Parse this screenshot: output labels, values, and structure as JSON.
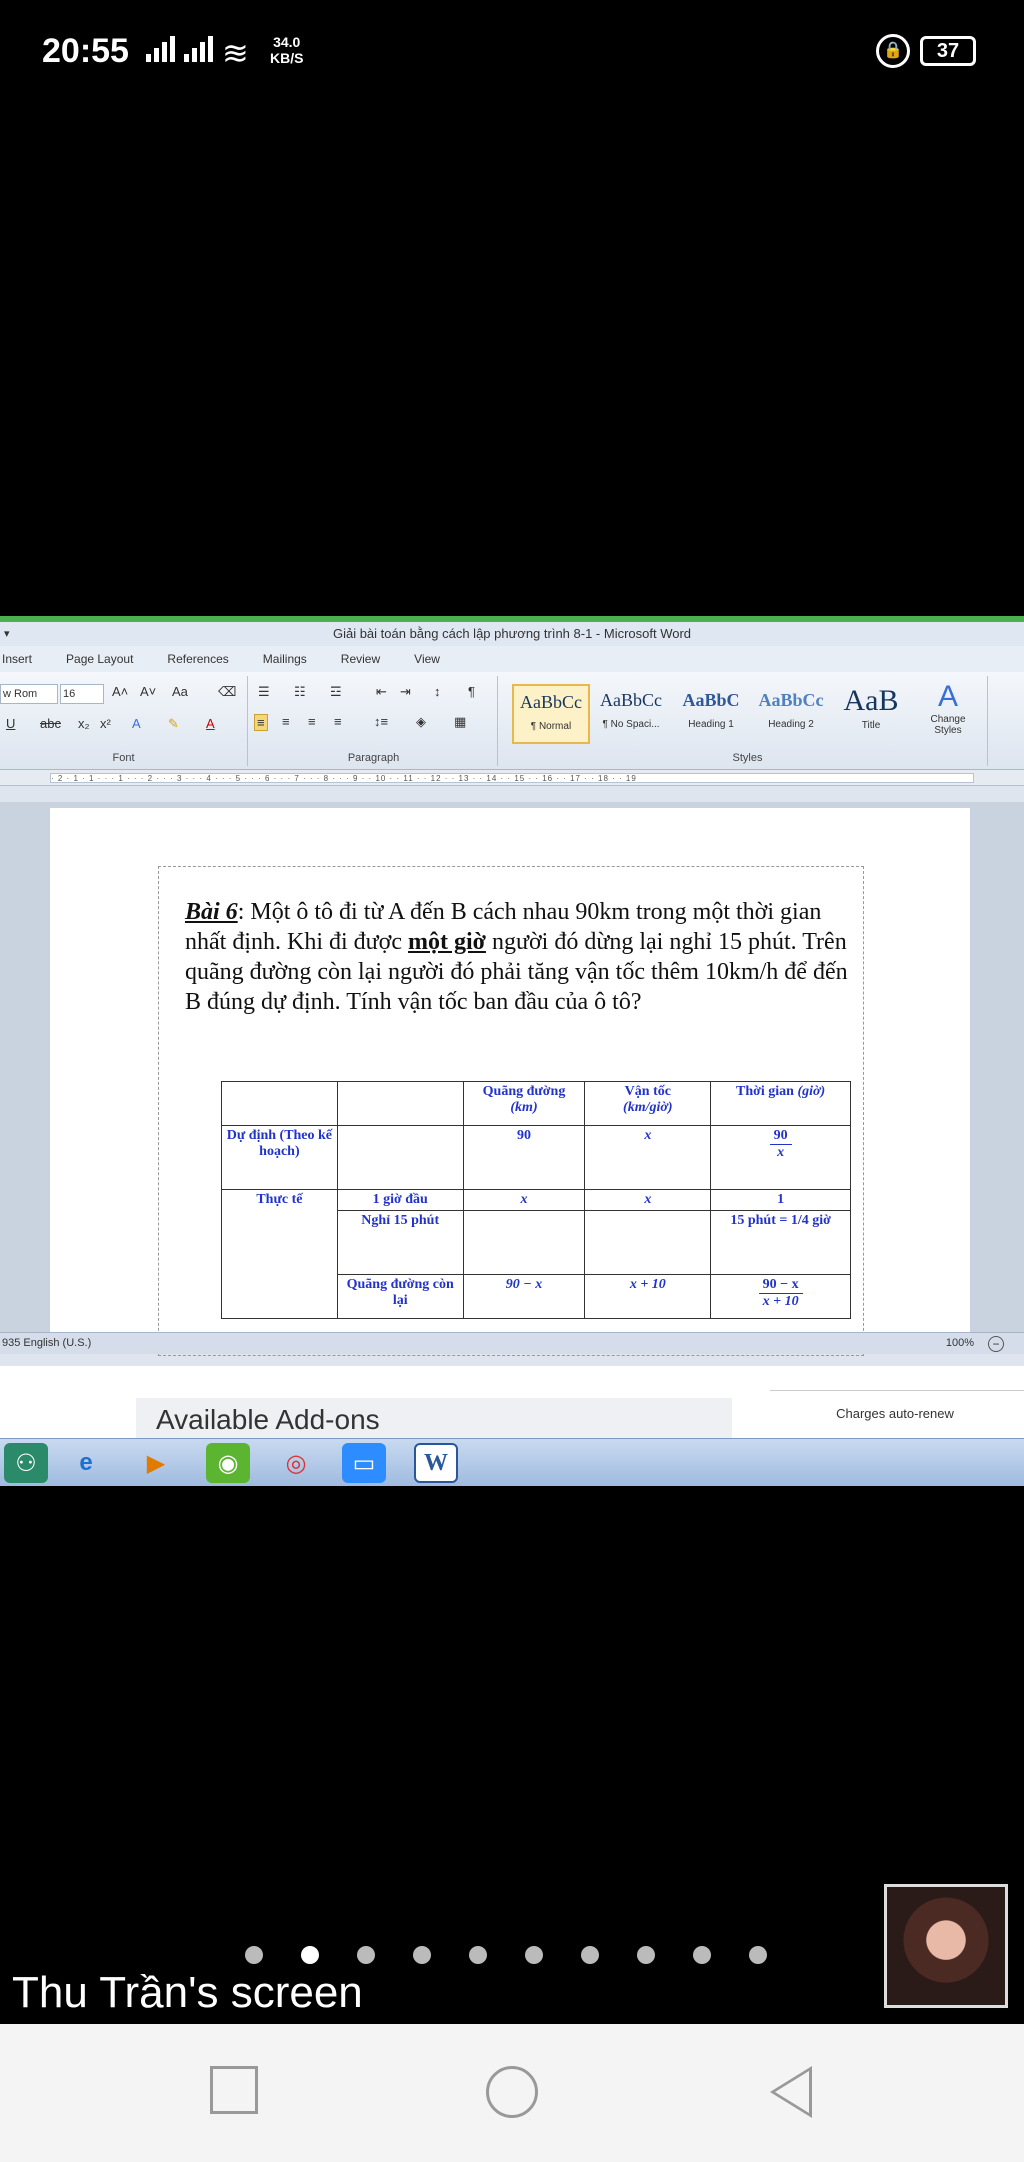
{
  "status": {
    "time": "20:55",
    "speed_value": "34.0",
    "speed_unit": "KB/S",
    "battery": "37"
  },
  "word": {
    "title": "Giải bài toán bằng cách lập phương trình 8-1  -  Microsoft Word",
    "tabs": [
      "Insert",
      "Page Layout",
      "References",
      "Mailings",
      "Review",
      "View"
    ],
    "font_name": "w Rom",
    "font_size": "16",
    "groups": {
      "font": "Font",
      "paragraph": "Paragraph",
      "styles": "Styles"
    },
    "styles": [
      {
        "sample": "AaBbCc",
        "name": "¶ Normal"
      },
      {
        "sample": "AaBbCc",
        "name": "¶ No Spaci..."
      },
      {
        "sample": "AaBbC",
        "name": "Heading 1"
      },
      {
        "sample": "AaBbCc",
        "name": "Heading 2"
      },
      {
        "sample": "AaB",
        "name": "Title"
      }
    ],
    "change_styles": "Change Styles",
    "ruler": "· 2 · 1 · 1 · · · 1 · · · 2 · · · 3 · · · 4 · · · 5 · · · 6 · · · 7 · · · 8 · · · 9 · · 10 · · 11 · · 12 · · 13 · · 14 · · 15 · · 16 · · 17 · · 18 · · 19",
    "doc": {
      "bai_label": "Bài 6",
      "para_1": ": Một ô tô đi từ A đến B cách nhau 90km trong một thời gian nhất định. Khi đi được ",
      "highlight": "một giờ",
      "para_2": " người đó dừng lại nghỉ 15 phút. Trên quãng đường còn lại người đó phải tăng vận tốc thêm 10km/h để đến B đúng dự định. Tính vận tốc ban đầu của ô tô?"
    },
    "table": {
      "h_distance": "Quãng đường",
      "h_distance_unit": "(km)",
      "h_speed": "Vận tốc",
      "h_speed_unit": "(km/giờ)",
      "h_time": "Thời gian",
      "h_time_unit": "(giờ)",
      "r1_label": "Dự định (Theo kế hoạch)",
      "r1_distance": "90",
      "r1_speed": "x",
      "r1_time_num": "90",
      "r1_time_den": "x",
      "r2_label": "Thực tế",
      "r2a_sub": "1 giờ đầu",
      "r2a_distance": "x",
      "r2a_speed": "x",
      "r2a_time": "1",
      "r2b_sub": "Nghỉ 15 phút",
      "r2b_time": "15 phút = 1/4 giờ",
      "r2c_sub": "Quãng đường còn lại",
      "r2c_distance": "90 − x",
      "r2c_speed": "x + 10",
      "r2c_time_num": "90 − x",
      "r2c_time_den": "x + 10"
    },
    "statusbar_left": "935  English (U.S.)",
    "zoom": "100%"
  },
  "addons": {
    "title": "Available Add-ons",
    "charges": "Charges auto-renew"
  },
  "taskbar": {
    "word_label": "W"
  },
  "screen_name": "Thu Trần's screen"
}
